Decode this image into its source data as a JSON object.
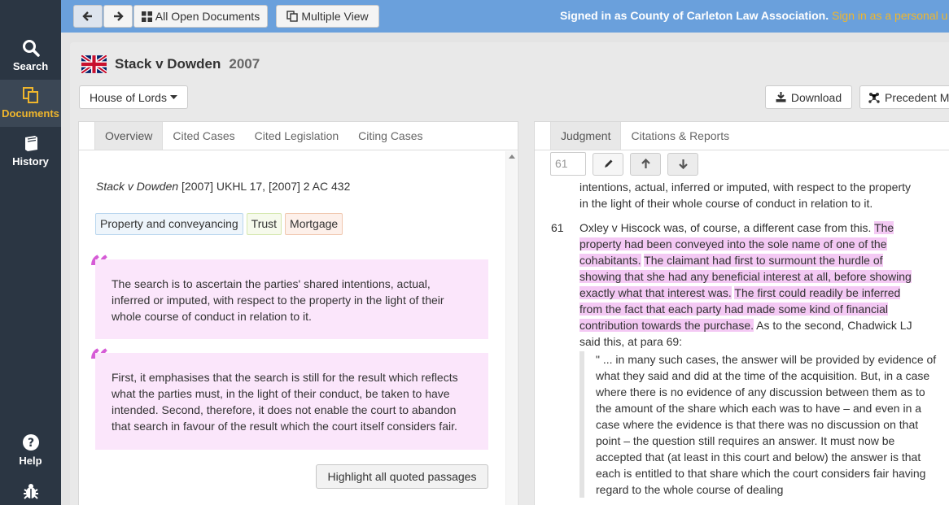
{
  "nav": {
    "search_label": "Search",
    "documents_label": "Documents",
    "history_label": "History",
    "help_label": "Help"
  },
  "topbar": {
    "all_open_label": "All Open Documents",
    "multiple_view_label": "Multiple View",
    "signed_prefix": "Signed in as ",
    "org_name": "County of Carleton Law Association",
    "signed_sep": ". ",
    "personal_link": "Sign in as a personal u"
  },
  "document": {
    "title": "Stack v Dowden",
    "year": "2007",
    "court_label": "House of Lords",
    "download_label": "Download",
    "precedent_label": "Precedent Map"
  },
  "left_tabs": [
    "Overview",
    "Cited Cases",
    "Cited Legislation",
    "Citing Cases"
  ],
  "overview": {
    "case_name": "Stack v Dowden",
    "citation_rest": " [2007] UKHL 17, [2007] 2 AC 432",
    "tags": [
      "Property and conveyancing",
      "Trust",
      "Mortgage"
    ],
    "quotes": [
      "The search is to ascertain the parties' shared intentions, actual, inferred or imputed, with respect to the property in the light of their whole course of conduct in relation to it.",
      "First, it emphasises that the search is still for the result which reflects what the parties must, in the light of their conduct, be taken to have intended. Second, therefore, it does not enable the court to abandon that search in favour of the result which the court itself considers fair."
    ],
    "highlight_button": "Highlight all quoted passages"
  },
  "right_tabs": [
    "Judgment",
    "Citations & Reports"
  ],
  "judgment": {
    "para_input": "61",
    "prev_text": "intentions, actual, inferred or imputed, with respect to the property in the light of their whole course of conduct in relation to it.",
    "para_num": "61",
    "para_a": "Oxley v Hiscock was, of course, a different case from this. ",
    "para_b": "The property had been conveyed into the sole name of one of the cohabitants.",
    "para_c": " ",
    "para_d": "The claimant had first to surmount the hurdle of showing that she had any beneficial interest at all, before showing exactly what that interest was.",
    "para_e": " ",
    "para_f": "The first could readily be inferred from the fact that each party had made some kind of financial contribution towards the purchase.",
    "para_g": " As to the second, Chadwick LJ said this, at para 69:",
    "quote": "\" ... in many such cases, the answer will be provided by evidence of what they said and did at the time of the acquisition. But, in a case where there is no evidence of any discussion between them as to the amount of the share which each was to have – and even in a case where the evidence is that there was no discussion on that point – the question still requires an answer. It must now be accepted that (at least in this court and below) the answer is that each is entitled to that share which the court considers fair having regard to the whole course of dealing"
  }
}
